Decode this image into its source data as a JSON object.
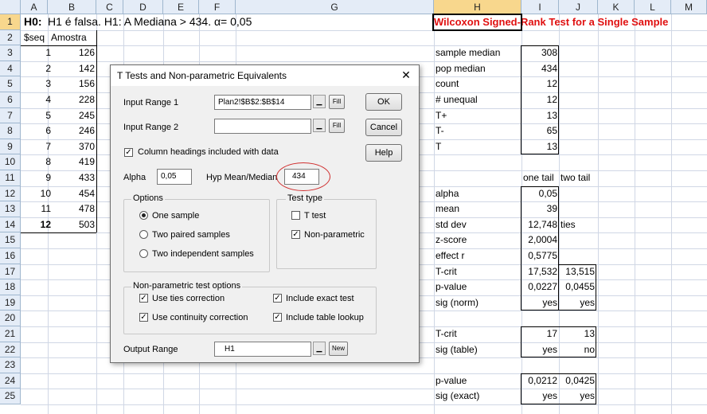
{
  "columns": [
    "A",
    "B",
    "C",
    "D",
    "E",
    "F",
    "G",
    "H",
    "I",
    "J",
    "K",
    "L",
    "M"
  ],
  "rows": [
    "1",
    "2",
    "3",
    "4",
    "5",
    "6",
    "7",
    "8",
    "9",
    "10",
    "11",
    "12",
    "13",
    "14",
    "15",
    "16",
    "17",
    "18",
    "19",
    "20",
    "21",
    "22",
    "23",
    "24",
    "25"
  ],
  "cells": {
    "a1": "H0:",
    "b1": "H1 é falsa. H1: A Mediana > 434. α= 0,05",
    "h1": "Wilcoxon Signed-Rank Test for a Single Sample",
    "a2": "$seq",
    "b2": "Amostra",
    "seq": [
      "1",
      "2",
      "3",
      "4",
      "5",
      "6",
      "7",
      "8",
      "9",
      "10",
      "11",
      "12"
    ],
    "amostra": [
      "126",
      "142",
      "156",
      "228",
      "245",
      "246",
      "370",
      "419",
      "433",
      "454",
      "478",
      "503"
    ],
    "labels1": [
      "sample median",
      "pop median",
      "count",
      "# unequal",
      "T+",
      "T-",
      "T"
    ],
    "values1": [
      "308",
      "434",
      "12",
      "12",
      "13",
      "65",
      "13"
    ],
    "hdr_one": "one tail",
    "hdr_two": "two tail",
    "labels2": [
      "alpha",
      "mean",
      "std dev",
      "z-score",
      "effect r",
      "T-crit",
      "p-value",
      "sig (norm)"
    ],
    "i2": [
      "0,05",
      "39",
      "12,748",
      "2,0004",
      "0,5775",
      "17,532",
      "0,0227",
      "yes"
    ],
    "j_ties": "ties",
    "j_tcrit": "13,515",
    "j_p": "0,0455",
    "j_sig": "yes",
    "labels3": [
      "T-crit",
      "sig (table)"
    ],
    "i3": [
      "17",
      "yes"
    ],
    "j3": [
      "13",
      "no"
    ],
    "labels4": [
      "p-value",
      "sig (exact)"
    ],
    "i4": [
      "0,0212",
      "yes"
    ],
    "j4": [
      "0,0425",
      "yes"
    ]
  },
  "dialog": {
    "title": "T Tests and Non-parametric Equivalents",
    "close": "✕",
    "input_range_1_label": "Input Range 1",
    "input_range_1_value": "Plan2!$B$2:$B$14",
    "input_range_2_label": "Input Range 2",
    "input_range_2_value": "",
    "fill": "Fill",
    "dropdown_symbol": "▁",
    "column_headings_label": "Column headings included with data",
    "alpha_label": "Alpha",
    "alpha_value": "0,05",
    "hyp_label": "Hyp Mean/Median",
    "hyp_value": "434",
    "ok": "OK",
    "cancel": "Cancel",
    "help": "Help",
    "options_title": "Options",
    "one_sample": "One sample",
    "two_paired": "Two paired samples",
    "two_indep": "Two independent samples",
    "test_type_title": "Test type",
    "t_test": "T test",
    "non_param": "Non-parametric",
    "np_options_title": "Non-parametric test options",
    "ties": "Use ties correction",
    "exact": "Include exact test",
    "continuity": "Use continuity correction",
    "table": "Include table lookup",
    "output_label": "Output Range",
    "output_value": "H1",
    "new": "New",
    "check_mark": "✓"
  },
  "colors": {
    "header_bg": "#e4ecf7",
    "selected_header": "#f8d78d",
    "title_red": "#e01010",
    "oval": "#d03030"
  }
}
